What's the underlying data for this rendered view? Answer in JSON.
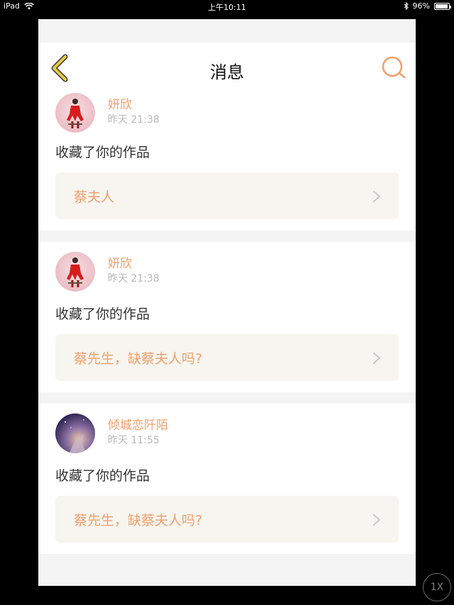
{
  "status": {
    "device": "iPad",
    "time": "上午10:11",
    "battery": "96%",
    "battery_level": 0.96
  },
  "navbar": {
    "title": "消息"
  },
  "messages": [
    {
      "username": "妍欣",
      "time": "昨天 21:38",
      "action": "收藏了你的作品",
      "work_title": "蔡夫人"
    },
    {
      "username": "妍欣",
      "time": "昨天 21:38",
      "action": "收藏了你的作品",
      "work_title": "蔡先生，缺蔡夫人吗?"
    },
    {
      "username": "倾城恋阡陌",
      "time": "昨天 11:55",
      "action": "收藏了你的作品",
      "work_title": "蔡先生，缺蔡夫人吗?"
    }
  ],
  "zoom_label": "1X",
  "colors": {
    "accent": "#f0a06c",
    "back_chevron": "#e8c84a",
    "work_box_bg": "#f6f5f0"
  }
}
